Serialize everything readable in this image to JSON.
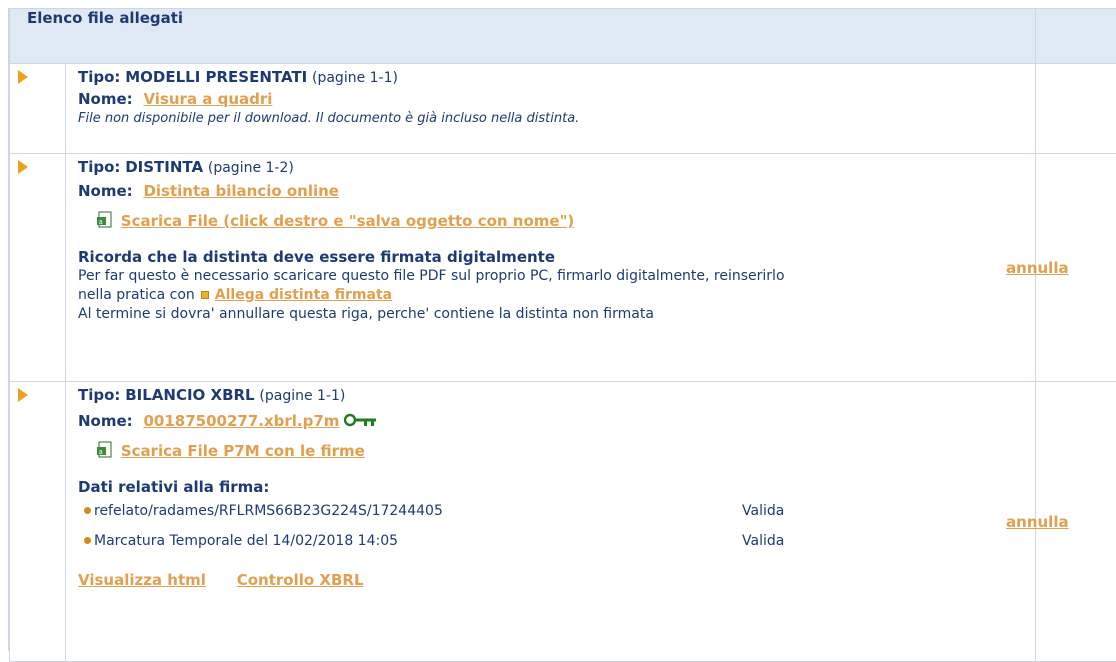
{
  "header": {
    "title": "Elenco file allegati"
  },
  "rows": [
    {
      "tipo_label": "Tipo:",
      "tipo_value": "MODELLI PRESENTATI",
      "tipo_pages": "(pagine 1-1)",
      "nome_label": "Nome:",
      "nome_value": "Visura a quadri",
      "note": "File non disponibile per il download. Il documento è già incluso nella distinta."
    },
    {
      "tipo_label": "Tipo:",
      "tipo_value": "DISTINTA",
      "tipo_pages": "(pagine 1-2)",
      "nome_label": "Nome:",
      "nome_value": "Distinta bilancio online",
      "download": "Scarica File (click destro e \"salva oggetto con nome\")",
      "reminder_title": "Ricorda che la distinta deve essere firmata digitalmente",
      "reminder_line1": "Per far questo è necessario scaricare questo file PDF sul proprio PC, firmarlo digitalmente, reinserirlo",
      "reminder_line2": "nella pratica con",
      "reminder_link": "Allega distinta firmata",
      "reminder_line3": "Al termine si dovra' annullare questa riga, perche' contiene la distinta non firmata",
      "action": "annulla"
    },
    {
      "tipo_label": "Tipo:",
      "tipo_value": "BILANCIO XBRL",
      "tipo_pages": "(pagine 1-1)",
      "nome_label": "Nome:",
      "nome_value": "00187500277.xbrl.p7m",
      "download": "Scarica File P7M con le firme",
      "sig_title": "Dati relativi alla firma:",
      "signatures": [
        {
          "name": "refelato/radames/RFLRMS66B23G224S/17244405",
          "status": "Valida"
        },
        {
          "name": "Marcatura Temporale del 14/02/2018 14:05",
          "status": "Valida"
        }
      ],
      "link_html": "Visualizza html",
      "link_xbrl": "Controllo XBRL",
      "action": "annulla"
    }
  ],
  "colors": {
    "header_bg": "#dfe8f5",
    "link": "#e0a050",
    "text": "#1f3a73",
    "arrow": "#f0a020",
    "key": "#1e7d1e"
  }
}
